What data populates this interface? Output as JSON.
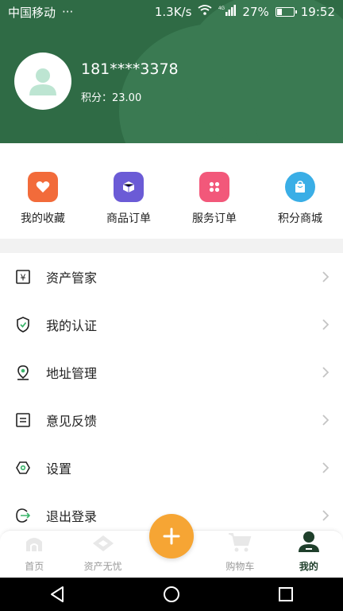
{
  "status_bar": {
    "carrier": "中国移动",
    "dots": "···",
    "speed": "1.3K/s",
    "battery": "27%",
    "battery_level": 0.27,
    "time": "19:52"
  },
  "profile": {
    "phone": "181****3378",
    "points_label": "积分：23.00"
  },
  "quick_actions": [
    {
      "label": "我的收藏",
      "icon": "heart-icon",
      "color": "#f26b3a"
    },
    {
      "label": "商品订单",
      "icon": "box-icon",
      "color": "#6b5bd6"
    },
    {
      "label": "服务订单",
      "icon": "grid-icon",
      "color": "#f2587a"
    },
    {
      "label": "积分商城",
      "icon": "shopping-bag-icon",
      "color": "#3aaee6"
    }
  ],
  "menu": [
    {
      "label": "资产管家",
      "icon": "yen-icon"
    },
    {
      "label": "我的认证",
      "icon": "shield-check-icon"
    },
    {
      "label": "地址管理",
      "icon": "location-pin-icon"
    },
    {
      "label": "意见反馈",
      "icon": "feedback-icon"
    },
    {
      "label": "设置",
      "icon": "settings-icon"
    },
    {
      "label": "退出登录",
      "icon": "logout-icon"
    }
  ],
  "tabbar": {
    "home": "首页",
    "assets": "资产无忧",
    "cart": "购物车",
    "mine": "我的",
    "active_color": "#1f3f2b"
  },
  "colors": {
    "header": "#2f6b45",
    "fab": "#f6a534"
  }
}
